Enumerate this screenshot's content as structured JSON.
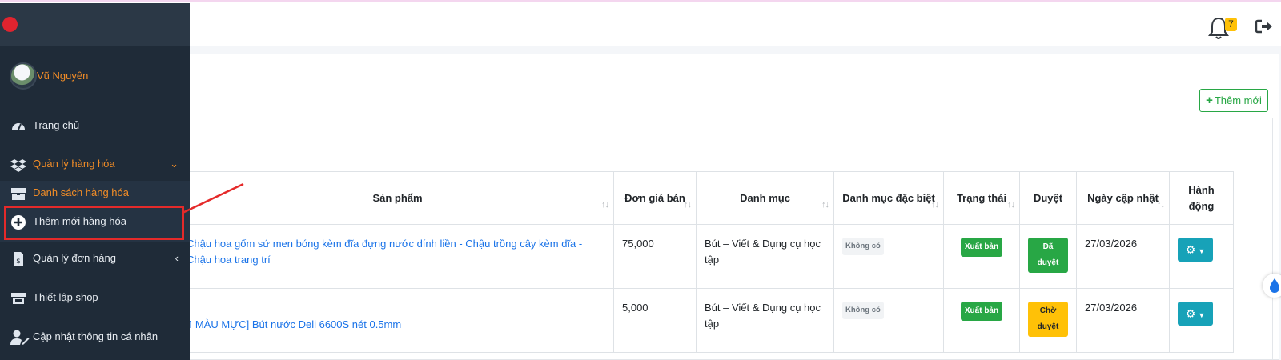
{
  "header": {
    "notification_count": "7"
  },
  "content": {
    "add_button_label": "Thêm mới"
  },
  "table": {
    "columns": [
      {
        "label": "Sản phẩm",
        "sortable": true
      },
      {
        "label": "Đơn giá bán",
        "sortable": true
      },
      {
        "label": "Danh mục",
        "sortable": true
      },
      {
        "label": "Danh mục đặc biệt",
        "sortable": true
      },
      {
        "label": "Trạng thái",
        "sortable": true
      },
      {
        "label": "Duyệt",
        "sortable": false
      },
      {
        "label": "Ngày cập nhật",
        "sortable": true
      },
      {
        "label": "Hành động",
        "sortable": false
      }
    ],
    "rows": [
      {
        "product": "Chậu hoa gốm sứ men bóng kèm đĩa đựng nước dính liền - Chậu trồng cây kèm dĩa - Chậu hoa trang trí",
        "price": "75,000",
        "category": "Bút – Viết & Dụng cụ học tập",
        "special_category": "Không có",
        "status": "Xuất bản",
        "approval": "Đã duyệt",
        "approval_color": "#28a745",
        "updated": "27/03/2026"
      },
      {
        "product": "4 MÀU MỰC] Bút nước Deli 6600S nét 0.5mm",
        "price": "5,000",
        "category": "Bút – Viết & Dụng cụ học tập",
        "special_category": "Không có",
        "status": "Xuất bản",
        "approval": "Chờ duyệt",
        "approval_color": "#ffc107",
        "updated": "27/03/2026"
      }
    ]
  },
  "sidebar": {
    "user_name": "Vũ Nguyên",
    "items": [
      {
        "label": "Trang chủ",
        "icon": "dashboard-icon"
      },
      {
        "label": "Quản lý hàng hóa",
        "icon": "dropbox-icon",
        "expanded": true
      },
      {
        "label": "Danh sách hàng hóa",
        "icon": "box-icon"
      },
      {
        "label": "Thêm mới hàng hóa",
        "icon": "plus-circle-icon"
      },
      {
        "label": "Quản lý đơn hàng",
        "icon": "invoice-icon"
      },
      {
        "label": "Thiết lập shop",
        "icon": "store-icon"
      },
      {
        "label": "Cập nhật thông tin cá nhân",
        "icon": "user-edit-icon"
      }
    ],
    "accent_color": "#f08c27",
    "highlight_color": "#e52a2a"
  }
}
